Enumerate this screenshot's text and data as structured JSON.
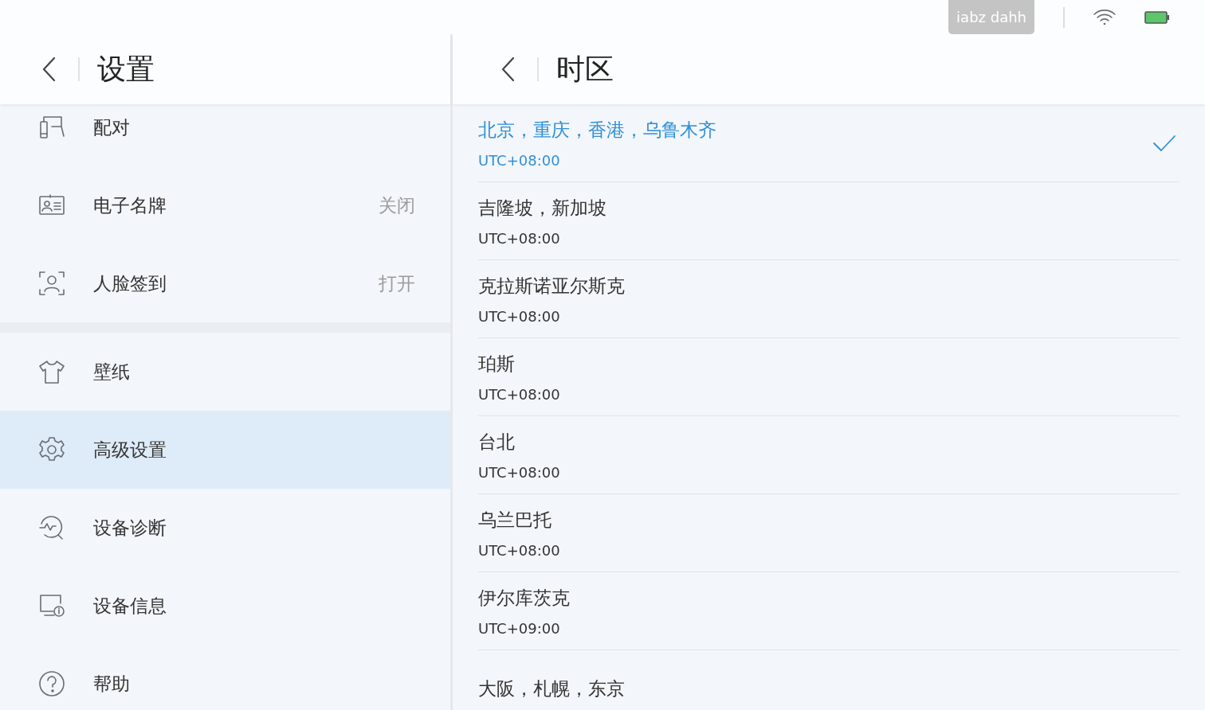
{
  "status_bar": {
    "badge": "iabz dahh"
  },
  "sidebar": {
    "title": "设置",
    "groups": [
      {
        "items": [
          {
            "label": "配对",
            "selected": false
          },
          {
            "label": "电子名牌",
            "value": "关闭",
            "selected": false
          },
          {
            "label": "人脸签到",
            "value": "打开",
            "selected": false
          }
        ]
      },
      {
        "items": [
          {
            "label": "壁纸",
            "selected": false
          },
          {
            "label": "高级设置",
            "selected": true
          },
          {
            "label": "设备诊断",
            "selected": false
          },
          {
            "label": "设备信息",
            "selected": false
          },
          {
            "label": "帮助",
            "selected": false
          }
        ]
      }
    ]
  },
  "detail": {
    "title": "时区",
    "options": [
      {
        "name": "北京，重庆，香港，乌鲁木齐",
        "offset": "UTC+08:00",
        "selected": true
      },
      {
        "name": "吉隆坡，新加坡",
        "offset": "UTC+08:00",
        "selected": false
      },
      {
        "name": "克拉斯诺亚尔斯克",
        "offset": "UTC+08:00",
        "selected": false
      },
      {
        "name": "珀斯",
        "offset": "UTC+08:00",
        "selected": false
      },
      {
        "name": "台北",
        "offset": "UTC+08:00",
        "selected": false
      },
      {
        "name": "乌兰巴托",
        "offset": "UTC+08:00",
        "selected": false
      },
      {
        "name": "伊尔库茨克",
        "offset": "UTC+09:00",
        "selected": false
      },
      {
        "name": "大阪，札幌，东京",
        "selected": false
      }
    ]
  }
}
